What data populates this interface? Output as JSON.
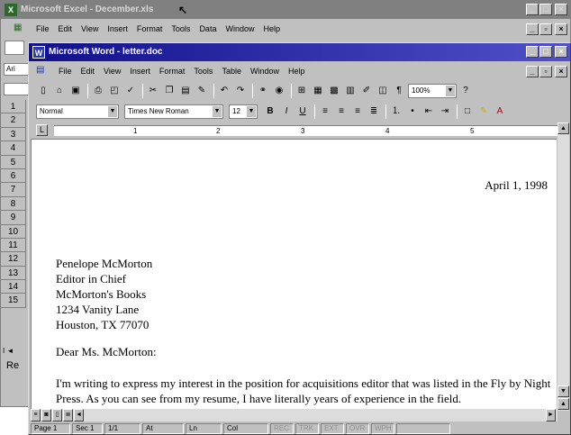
{
  "excel": {
    "title": "Microsoft Excel - December.xls",
    "menu": [
      "File",
      "Edit",
      "View",
      "Insert",
      "Format",
      "Tools",
      "Data",
      "Window",
      "Help"
    ],
    "font_stub": "Ari",
    "rows": [
      "1",
      "2",
      "3",
      "4",
      "5",
      "6",
      "7",
      "8",
      "9",
      "10",
      "11",
      "12",
      "13",
      "14",
      "15"
    ],
    "sheet_nav": "I ◄",
    "status": "Re"
  },
  "word": {
    "title": "Microsoft Word - letter.doc",
    "menu": [
      "File",
      "Edit",
      "View",
      "Insert",
      "Format",
      "Tools",
      "Table",
      "Window",
      "Help"
    ],
    "zoom": "100%",
    "style": "Normal",
    "font": "Times New Roman",
    "size": "12",
    "ruler_numbers": [
      "1",
      "2",
      "3",
      "4",
      "5"
    ],
    "document": {
      "date": "April 1, 1998",
      "address": [
        "Penelope McMorton",
        "Editor in Chief",
        "McMorton's Books",
        "1234 Vanity Lane",
        "Houston, TX 77070"
      ],
      "greeting": "Dear Ms. McMorton:",
      "body": "I'm writing to express my interest in the position for acquisitions editor that was listed in the Fly by Night Press. As you can see from my resume, I have literally years of experience in the field."
    },
    "status": {
      "page": "Page 1",
      "sec": "Sec 1",
      "of": "1/1",
      "at": "At",
      "ln": "Ln",
      "col": "Col",
      "rec": "REC",
      "trk": "TRK",
      "ext": "EXT",
      "ovr": "OVR",
      "wph": "WPH"
    }
  },
  "colors": {
    "active_title": "#10108a",
    "inactive_title": "#808080",
    "chrome": "#c0c0c0"
  }
}
